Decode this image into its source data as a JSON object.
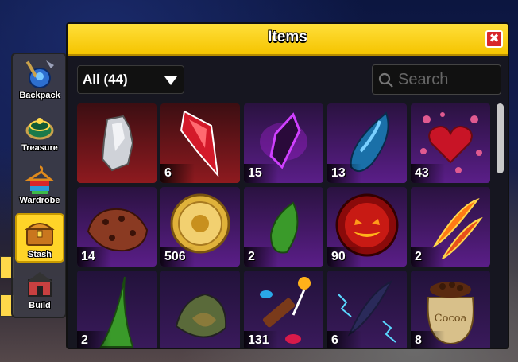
{
  "sidebar": {
    "items": [
      {
        "label": "Backpack",
        "icon": "backpack-icon",
        "active": false
      },
      {
        "label": "Treasure",
        "icon": "treasure-icon",
        "active": false
      },
      {
        "label": "Wardrobe",
        "icon": "wardrobe-icon",
        "active": false
      },
      {
        "label": "Stash",
        "icon": "stash-chest-icon",
        "active": true
      },
      {
        "label": "Build",
        "icon": "build-icon",
        "active": false
      }
    ]
  },
  "window": {
    "title": "Items",
    "close_label": "✖"
  },
  "filter": {
    "selected": "All (44)"
  },
  "search": {
    "placeholder": "Search"
  },
  "items": [
    {
      "icon": "silver-rock-icon",
      "count": "",
      "bg": "red"
    },
    {
      "icon": "red-crystal-icon",
      "count": "6",
      "bg": "red"
    },
    {
      "icon": "purple-crystal-icon",
      "count": "15",
      "bg": "purple"
    },
    {
      "icon": "blue-gem-icon",
      "count": "13",
      "bg": "purple"
    },
    {
      "icon": "hearts-icon",
      "count": "43",
      "bg": "purple"
    },
    {
      "icon": "lava-rock-icon",
      "count": "14",
      "bg": "purple"
    },
    {
      "icon": "sun-coin-icon",
      "count": "506",
      "bg": "purple"
    },
    {
      "icon": "green-leaf-icon",
      "count": "2",
      "bg": "purple"
    },
    {
      "icon": "pumpkin-face-icon",
      "count": "90",
      "bg": "purple"
    },
    {
      "icon": "fire-feathers-icon",
      "count": "2",
      "bg": "purple"
    },
    {
      "icon": "green-fin-icon",
      "count": "2",
      "bg": "dark"
    },
    {
      "icon": "mossy-rock-icon",
      "count": "",
      "bg": "dark"
    },
    {
      "icon": "candy-icon",
      "count": "131",
      "bg": "dark"
    },
    {
      "icon": "electric-feather-icon",
      "count": "6",
      "bg": "dark"
    },
    {
      "icon": "cocoa-sack-icon",
      "count": "8",
      "bg": "dark"
    }
  ],
  "cocoa_label": "Cocoa",
  "colors": {
    "accent": "#ffd428",
    "close": "#d8262a",
    "panel": "#161620"
  }
}
